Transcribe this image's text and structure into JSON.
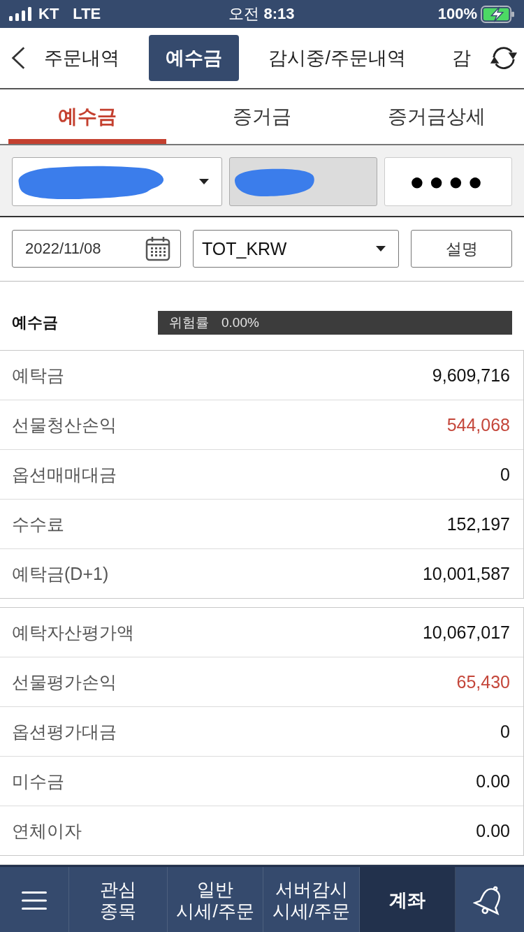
{
  "status_bar": {
    "carrier": "KT",
    "network": "LTE",
    "time": "오전 **8:13**",
    "battery": "100%"
  },
  "top_tabs": [
    {
      "label": "주문내역",
      "selected": false
    },
    {
      "label": "예수금",
      "selected": true
    },
    {
      "label": "감시중/주문내역",
      "selected": false
    },
    {
      "label": "감",
      "selected": false
    }
  ],
  "sub_tabs": [
    {
      "label": "예수금",
      "selected": true
    },
    {
      "label": "증거금",
      "selected": false
    },
    {
      "label": "증거금상세",
      "selected": false
    }
  ],
  "account": {
    "password": "●●●●"
  },
  "filters": {
    "date": "2022/11/08",
    "currency": "TOT_KRW",
    "help_button": "설명"
  },
  "summary": {
    "title": "예수금",
    "risk_label": "위험률",
    "risk_value": "0.00%"
  },
  "tables": [
    {
      "rows": [
        {
          "label": "예탁금",
          "value": "9,609,716",
          "color": "#111111"
        },
        {
          "label": "선물청산손익",
          "value": "544,068",
          "color": "#c4463a"
        },
        {
          "label": "옵션매매대금",
          "value": "0",
          "color": "#111111"
        },
        {
          "label": "수수료",
          "value": "152,197",
          "color": "#111111"
        },
        {
          "label": "예탁금(D+1)",
          "value": "10,001,587",
          "color": "#111111"
        }
      ]
    },
    {
      "rows": [
        {
          "label": "예탁자산평가액",
          "value": "10,067,017",
          "color": "#111111"
        },
        {
          "label": "선물평가손익",
          "value": "65,430",
          "color": "#c4463a"
        },
        {
          "label": "옵션평가대금",
          "value": "0",
          "color": "#111111"
        },
        {
          "label": "미수금",
          "value": "0.00",
          "color": "#111111"
        },
        {
          "label": "연체이자",
          "value": "0.00",
          "color": "#111111"
        }
      ]
    }
  ],
  "bottom_nav": [
    {
      "kind": "menu",
      "selected": false
    },
    {
      "kind": "text",
      "lines": [
        "관심",
        "종목"
      ],
      "selected": false
    },
    {
      "kind": "text",
      "lines": [
        "일반",
        "시세/주문"
      ],
      "selected": false
    },
    {
      "kind": "text",
      "lines": [
        "서버감시",
        "시세/주문"
      ],
      "selected": false
    },
    {
      "kind": "text",
      "lines": [
        "계좌"
      ],
      "selected": true
    },
    {
      "kind": "bell",
      "selected": false
    }
  ]
}
